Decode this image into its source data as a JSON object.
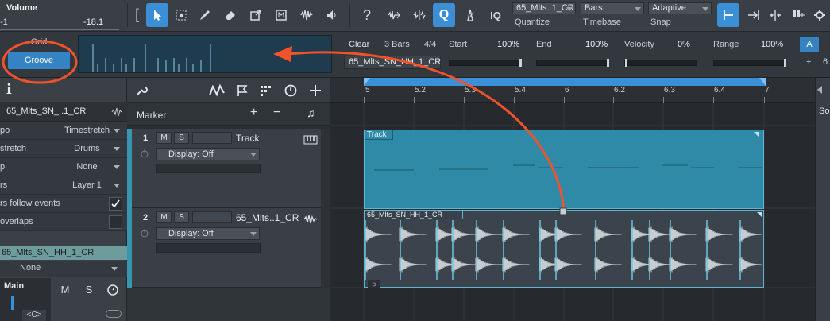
{
  "toolbar": {
    "volume_label": "Volume",
    "volume_value": "-18.1",
    "left_value": "-1",
    "quantize_value": "65_Mlts..1_CR",
    "quantize_label": "Quantize",
    "timebase_value": "Bars",
    "timebase_label": "Timebase",
    "snap_value": "Adaptive",
    "snap_label": "Snap",
    "help": "?",
    "iq": "IQ",
    "q": "Q"
  },
  "groove": {
    "grid_label": "Grid",
    "groove_label": "Groove",
    "clear_label": "Clear",
    "bars": "3 Bars",
    "meter": "4/4",
    "file": "65_Mlts_SN_HH_1_CR",
    "start_label": "Start",
    "start_value": "100%",
    "end_label": "End",
    "end_value": "100%",
    "velocity_label": "Velocity",
    "velocity_value": "0%",
    "range_label": "Range",
    "range_value": "100%",
    "a_label": "A",
    "plus": "+",
    "six": "6"
  },
  "inspector": {
    "info_icon": "i",
    "event_title": "65_Mlts_SN_..1_CR",
    "rows": [
      {
        "key": "po",
        "value": "Timestretch"
      },
      {
        "key": "stretch",
        "value": "Drums"
      },
      {
        "key": "p",
        "value": "None"
      },
      {
        "key": "rs",
        "value": "Layer 1"
      }
    ],
    "follow_label": "rs follow events",
    "overlaps_label": "overlaps",
    "channel_name": "65_Mlts_SN_HH_1_CR",
    "channel_value": "None",
    "main_label": "Main",
    "m": "M",
    "s": "S",
    "bottom_value": "<C>"
  },
  "tracks": {
    "marker_label": "Marker",
    "track1": {
      "number": "1",
      "name": "Track",
      "display": "Display: Off"
    },
    "track2": {
      "number": "2",
      "name": "65_Mlts..1_CR",
      "display": "Display: Off"
    },
    "m": "M",
    "s": "S"
  },
  "ruler": {
    "ticks": [
      "5",
      "5.2",
      "5.3",
      "5.4",
      "6",
      "6.2",
      "6.3",
      "6.4",
      "7"
    ]
  },
  "events": {
    "track_event": "Track",
    "audio_event": "65_Mlts_SN_HH_1_CR"
  },
  "right": {
    "label": "So"
  },
  "colors": {
    "accent": "#3b8fd6",
    "track_blue": "#2f8aa7",
    "annotation": "#f0522a"
  }
}
